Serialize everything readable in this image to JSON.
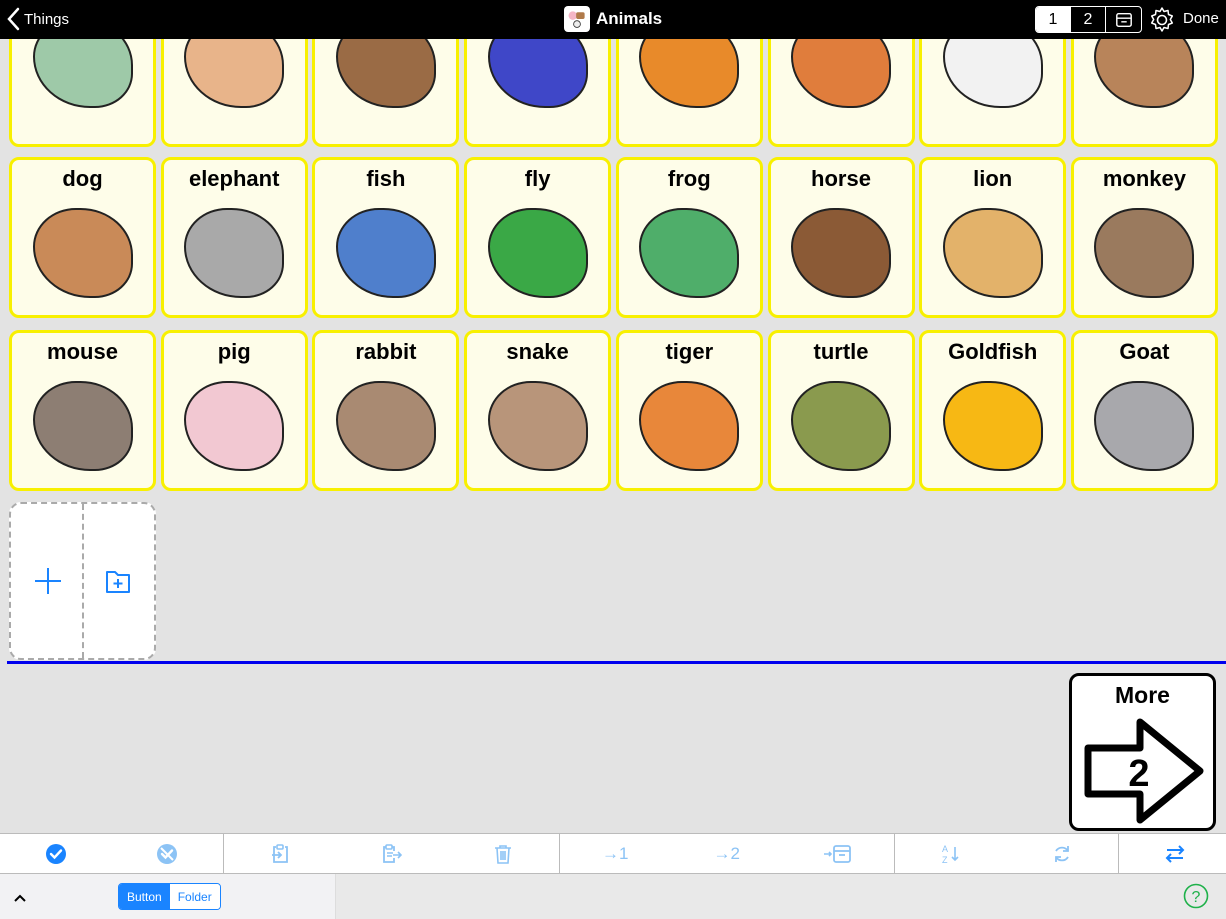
{
  "header": {
    "back_label": "Things",
    "title": "Animals",
    "pages": [
      "1",
      "2"
    ],
    "selected_page": "1",
    "done_label": "Done"
  },
  "cells_top_row": [
    {
      "label": "",
      "picture": "birds-frog-kangaroo",
      "color": "#9ec9a8"
    },
    {
      "label": "",
      "picture": "dog-cat-guinea-pig",
      "color": "#e8b48a"
    },
    {
      "label": "",
      "picture": "bear",
      "color": "#9a6b45"
    },
    {
      "label": "",
      "picture": "bird-on-branch",
      "color": "#3f47c8"
    },
    {
      "label": "",
      "picture": "butterfly",
      "color": "#e88a2a"
    },
    {
      "label": "",
      "picture": "cat",
      "color": "#e07d3c"
    },
    {
      "label": "",
      "picture": "chicken",
      "color": "#f2f2f2"
    },
    {
      "label": "",
      "picture": "cow",
      "color": "#b8845a"
    }
  ],
  "cells": [
    {
      "label": "dog",
      "color": "#c98a58"
    },
    {
      "label": "elephant",
      "color": "#a9a9a9"
    },
    {
      "label": "fish",
      "color": "#4f7fcc"
    },
    {
      "label": "fly",
      "color": "#3aa846"
    },
    {
      "label": "frog",
      "color": "#4fae6a"
    },
    {
      "label": "horse",
      "color": "#8b5a36"
    },
    {
      "label": "lion",
      "color": "#e3b26a"
    },
    {
      "label": "monkey",
      "color": "#9a7a5e"
    },
    {
      "label": "mouse",
      "color": "#8d7e73"
    },
    {
      "label": "pig",
      "color": "#f2c8d2"
    },
    {
      "label": "rabbit",
      "color": "#a98a72"
    },
    {
      "label": "snake",
      "color": "#b8957a"
    },
    {
      "label": "tiger",
      "color": "#e8873a"
    },
    {
      "label": "turtle",
      "color": "#8a9a4e"
    },
    {
      "label": "Goldfish",
      "color": "#f7b814"
    },
    {
      "label": "Goat",
      "color": "#a8a8ac"
    }
  ],
  "add": {
    "add_button_icon": "plus-icon",
    "add_folder_icon": "folder-plus-icon"
  },
  "more_button": {
    "label": "More",
    "target_page": "2"
  },
  "toolbar": {
    "groups": [
      [
        {
          "name": "select-all",
          "icon": "check-circle-icon"
        },
        {
          "name": "deselect-all",
          "icon": "uncheck-circle-icon"
        }
      ],
      [
        {
          "name": "import",
          "icon": "import-icon"
        },
        {
          "name": "copy-to",
          "icon": "copy-out-icon"
        },
        {
          "name": "delete",
          "icon": "trash-icon"
        }
      ],
      [
        {
          "name": "move-to-page-1",
          "label": "→1"
        },
        {
          "name": "move-to-page-2",
          "label": "→2"
        },
        {
          "name": "move-to-archive",
          "icon": "archive-icon"
        }
      ],
      [
        {
          "name": "sort",
          "icon": "sort-az-icon"
        },
        {
          "name": "refresh",
          "icon": "refresh-icon"
        }
      ],
      [
        {
          "name": "swap",
          "icon": "swap-icon"
        }
      ]
    ]
  },
  "bottom": {
    "segments": [
      "Button",
      "Folder"
    ],
    "selected_segment": "Button"
  },
  "colors": {
    "accent": "#1a84ff",
    "cell_border": "#f8f000",
    "cell_bg": "#fefde9",
    "divider": "#0000ee",
    "help": "#1fb14a"
  }
}
